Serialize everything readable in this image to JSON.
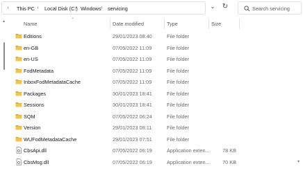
{
  "breadcrumb": {
    "items": [
      {
        "label": "This PC"
      },
      {
        "label": "Local Disk (C:)"
      },
      {
        "label": "Windows"
      },
      {
        "label": "servicing"
      }
    ]
  },
  "search": {
    "placeholder": "Search servicing"
  },
  "columns": {
    "name": "Name",
    "date": "Date modified",
    "type": "Type",
    "size": "Size"
  },
  "files": [
    {
      "name": "Editions",
      "date": "29/01/2023 08:40",
      "type": "File folder",
      "size": "",
      "icon": "folder-icon"
    },
    {
      "name": "en-GB",
      "date": "07/05/2022 11:09",
      "type": "File folder",
      "size": "",
      "icon": "folder-icon"
    },
    {
      "name": "en-US",
      "date": "07/05/2022 11:09",
      "type": "File folder",
      "size": "",
      "icon": "folder-icon"
    },
    {
      "name": "FodMetadata",
      "date": "07/05/2022 11:09",
      "type": "File folder",
      "size": "",
      "icon": "folder-icon"
    },
    {
      "name": "InboxFodMetadataCache",
      "date": "07/05/2022 11:09",
      "type": "File folder",
      "size": "",
      "icon": "folder-icon"
    },
    {
      "name": "Packages",
      "date": "30/01/2023 18:41",
      "type": "File folder",
      "size": "",
      "icon": "folder-icon"
    },
    {
      "name": "Sessions",
      "date": "30/01/2023 18:41",
      "type": "File folder",
      "size": "",
      "icon": "folder-icon"
    },
    {
      "name": "SQM",
      "date": "07/05/2022 06:24",
      "type": "File folder",
      "size": "",
      "icon": "folder-icon"
    },
    {
      "name": "Version",
      "date": "29/01/2023 08:11",
      "type": "File folder",
      "size": "",
      "icon": "folder-icon"
    },
    {
      "name": "WUFodMetadataCache",
      "date": "29/01/2023 07:51",
      "type": "File folder",
      "size": "",
      "icon": "folder-icon"
    },
    {
      "name": "CbsApi.dll",
      "date": "07/05/2022 06:19",
      "type": "Application exten...",
      "size": "78 KB",
      "icon": "dll-file-icon"
    },
    {
      "name": "CbsMsg.dll",
      "date": "07/05/2022 06:19",
      "type": "Application exten...",
      "size": "70 KB",
      "icon": "dll-file-icon"
    }
  ],
  "colors": {
    "folder": "#f3c44f",
    "folder_dark": "#dba83a",
    "accent": "#0067c0"
  }
}
